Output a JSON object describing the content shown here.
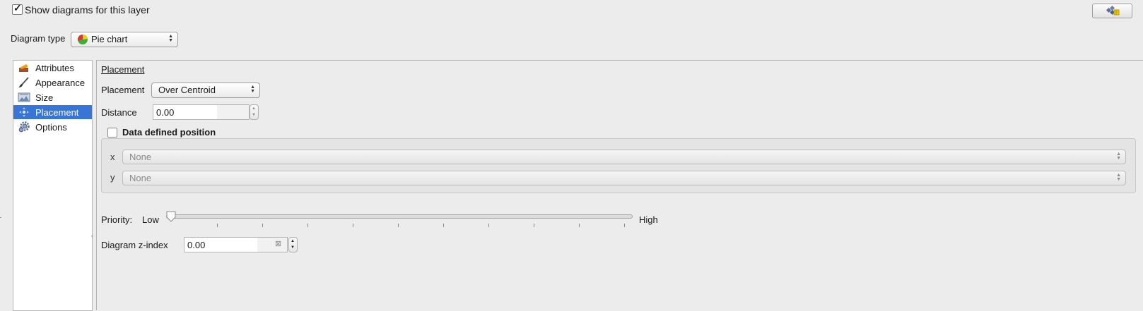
{
  "header": {
    "show_diagrams_label": "Show diagrams for this layer",
    "show_diagrams_checked": true,
    "legend_button_icon": "legend-diagram-icon"
  },
  "diagram_type": {
    "label": "Diagram type",
    "value": "Pie chart",
    "icon": "pie-chart-icon"
  },
  "sidebar": {
    "items": [
      {
        "label": "Attributes",
        "icon": "attributes-icon",
        "selected": false
      },
      {
        "label": "Appearance",
        "icon": "brush-icon",
        "selected": false
      },
      {
        "label": "Size",
        "icon": "size-icon",
        "selected": false
      },
      {
        "label": "Placement",
        "icon": "placement-icon",
        "selected": true
      },
      {
        "label": "Options",
        "icon": "gear-icon",
        "selected": false
      }
    ],
    "selected_color": "#3875d7"
  },
  "placement_section": {
    "title": "Placement",
    "placement_label": "Placement",
    "placement_value": "Over Centroid",
    "distance_label": "Distance",
    "distance_value": "0.00",
    "data_defined_label": "Data defined position",
    "data_defined_checked": false,
    "x_label": "x",
    "x_value": "None",
    "y_label": "y",
    "y_value": "None"
  },
  "priority": {
    "label": "Priority:",
    "low_label": "Low",
    "high_label": "High",
    "value_fraction": 0
  },
  "z_index": {
    "label": "Diagram z-index",
    "value": "0.00"
  }
}
